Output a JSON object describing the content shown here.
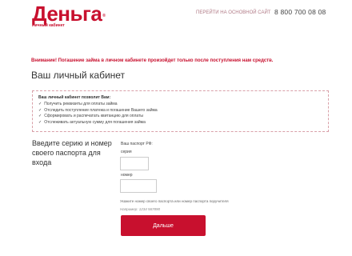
{
  "header": {
    "logo_text": "Деньга",
    "logo_registered": "®",
    "logo_subtitle": "Личный кабинет",
    "main_site_link": "ПЕРЕЙТИ НА ОСНОВНОЙ САЙТ",
    "phone": "8 800 700 08 08"
  },
  "notice": "Внимание! Погашение займа в личном кабинете произойдет только после поступления нам средств.",
  "page_title": "Ваш личный кабинет",
  "info": {
    "title": "Ваш личный кабинет позволит Вам:",
    "items": [
      "Получить реквизиты для оплаты займа",
      "Отследить поступление платежа и погашение Вашего займа",
      "Сформировать и распечатать квитанцию для оплаты",
      "Отслеживать актуальную сумму для погашения займа"
    ]
  },
  "form": {
    "prompt": "Введите серию и номер своего паспорта для входа",
    "passport_label": "Ваш паспорт РФ:",
    "series_label": "серия",
    "series_value": "",
    "number_label": "номер",
    "number_value": "",
    "hint": "Укажите номер своего паспорта или номер паспорта поручителя",
    "example": "Например: 1234 567890",
    "submit_label": "Дальше"
  },
  "colors": {
    "brand": "#c8102e",
    "dashed_border": "#d9a0a8"
  },
  "icons": {
    "check": "check-icon"
  }
}
